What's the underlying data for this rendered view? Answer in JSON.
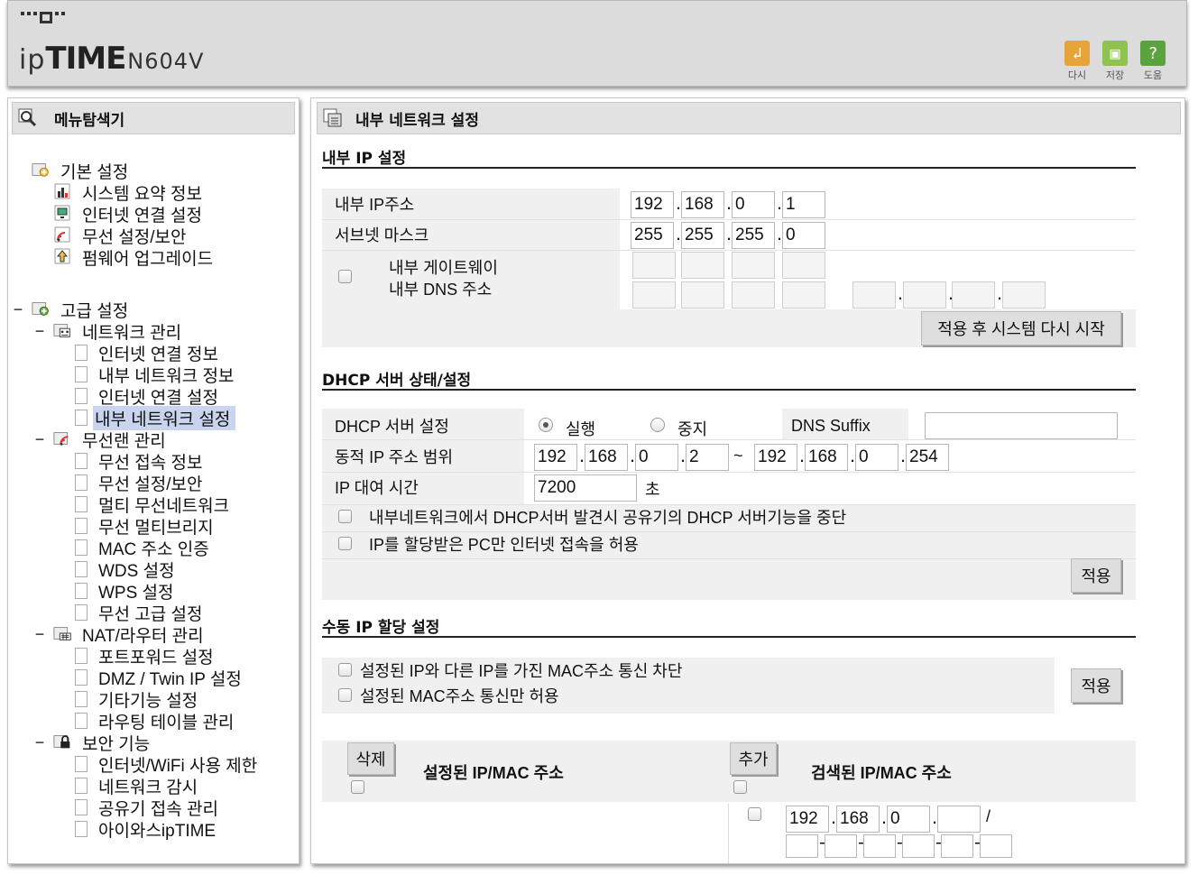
{
  "header": {
    "brand_ip": "ip",
    "brand_time": "TIME",
    "brand_model": "N604V",
    "tools": [
      {
        "label": "다시",
        "icon": "restart-icon",
        "color": "#e6a43a",
        "glyph": "↲"
      },
      {
        "label": "저장",
        "icon": "save-icon",
        "color": "#8fc24f",
        "glyph": "▣"
      },
      {
        "label": "도움",
        "icon": "help-icon",
        "color": "#5aa33e",
        "glyph": "?"
      }
    ]
  },
  "menu": {
    "title": "메뉴탐색기",
    "basic": {
      "label": "기본 설정",
      "items": [
        "시스템 요약 정보",
        "인터넷 연결 설정",
        "무선 설정/보안",
        "펌웨어 업그레이드"
      ]
    },
    "advanced": {
      "label": "고급 설정",
      "toggle": "−",
      "network": {
        "label": "네트워크 관리",
        "items": [
          "인터넷 연결 정보",
          "내부 네트워크 정보",
          "인터넷 연결 설정",
          "내부 네트워크 설정"
        ]
      },
      "wireless": {
        "label": "무선랜 관리",
        "items": [
          "무선 접속 정보",
          "무선 설정/보안",
          "멀티 무선네트워크",
          "무선 멀티브리지",
          "MAC 주소 인증",
          "WDS 설정",
          "WPS 설정",
          "무선 고급 설정"
        ]
      },
      "nat": {
        "label": "NAT/라우터 관리",
        "items": [
          "포트포워드 설정",
          "DMZ / Twin IP 설정",
          "기타기능 설정",
          "라우팅 테이블 관리"
        ]
      },
      "security": {
        "label": "보안 기능",
        "items": [
          "인터넷/WiFi 사용 제한",
          "네트워크 감시",
          "공유기 접속 관리",
          "아이와스ipTIME"
        ]
      }
    }
  },
  "main": {
    "title": "내부 네트워크 설정",
    "lan": {
      "section": "내부 IP 설정",
      "ip_label": "내부 IP주소",
      "ip": [
        "192",
        "168",
        "0",
        "1"
      ],
      "mask_label": "서브넷 마스크",
      "mask": [
        "255",
        "255",
        "255",
        "0"
      ],
      "gateway_label": "내부 게이트웨이",
      "dns_label": "내부 DNS 주소",
      "apply_restart": "적용 후 시스템 다시 시작"
    },
    "dhcp": {
      "section": "DHCP 서버 상태/설정",
      "server_label": "DHCP 서버 설정",
      "run_label": "실행",
      "stop_label": "중지",
      "dns_suffix_label": "DNS Suffix",
      "range_label": "동적 IP 주소 범위",
      "range_start": [
        "192",
        "168",
        "0",
        "2"
      ],
      "tilde": "~",
      "range_end": [
        "192",
        "168",
        "0",
        "254"
      ],
      "lease_label": "IP 대여 시간",
      "lease_value": "7200",
      "lease_unit": "초",
      "opt1": "내부네트워크에서 DHCP서버 발견시 공유기의 DHCP 서버기능을 중단",
      "opt2": "IP를 할당받은 PC만 인터넷 접속을 허용",
      "apply": "적용"
    },
    "manual": {
      "section": "수동 IP 할당 설정",
      "opt1": "설정된 IP와 다른 IP를 가진 MAC주소 통신 차단",
      "opt2": "설정된 MAC주소 통신만 허용",
      "apply": "적용",
      "delete": "삭제",
      "configured_label": "설정된 IP/MAC 주소",
      "add": "추가",
      "found_label": "검색된 IP/MAC 주소",
      "new_ip": [
        "192",
        "168",
        "0",
        ""
      ],
      "slash": "/"
    }
  }
}
